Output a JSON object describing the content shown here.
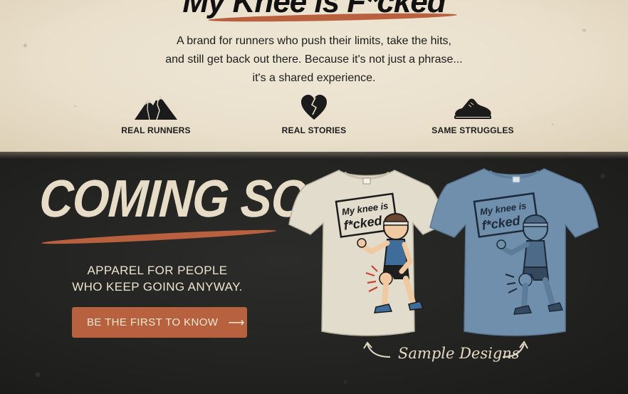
{
  "hero": {
    "headline": "My Knee is F*cked",
    "tagline_lines": [
      "A brand for runners who push their limits, take the hits,",
      "and still get back out there. Because it's not just a phrase...",
      "it's a shared experience."
    ]
  },
  "features": [
    {
      "icon": "mountain-icon",
      "label": "REAL RUNNERS"
    },
    {
      "icon": "heart-icon",
      "label": "REAL STORIES"
    },
    {
      "icon": "shoe-icon",
      "label": "SAME STRUGGLES"
    }
  ],
  "promo": {
    "coming_soon": "COMING SOON",
    "apparel_lines": [
      "APPAREL FOR PEOPLE",
      "WHO KEEP GOING ANYWAY."
    ],
    "cta_label": "BE THE FIRST TO KNOW",
    "cta_arrow": "⟶",
    "sample_caption": "Sample Designs"
  },
  "shirts": [
    {
      "color": "cream",
      "fill": "#e2dccd",
      "print_text_1": "My knee is",
      "print_text_2": "f*cked"
    },
    {
      "color": "blue",
      "fill": "#6f8fad",
      "print_text_1": "My knee is",
      "print_text_2": "f*cked"
    }
  ],
  "colors": {
    "accent": "#b8613f",
    "cream_bg": "#e9dfcb",
    "dark_bg": "#232321"
  }
}
